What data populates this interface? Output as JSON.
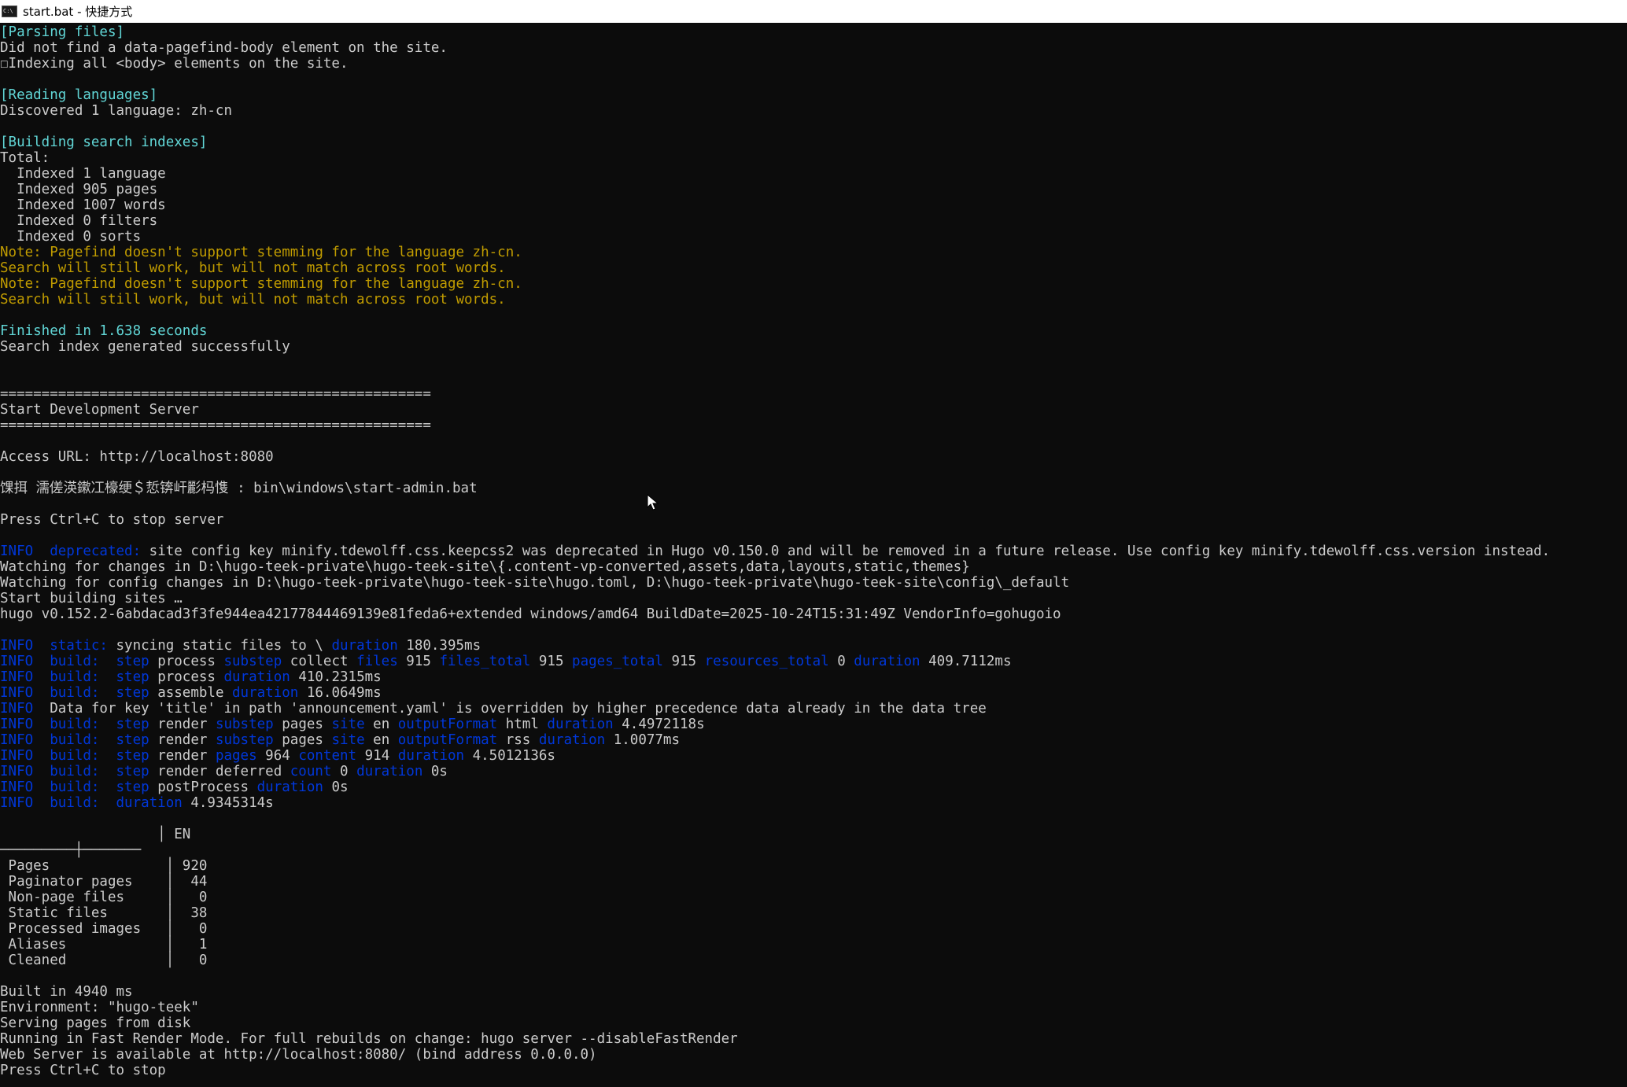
{
  "window": {
    "title": "start.bat - 快捷方式",
    "icon": "cmd-icon",
    "icon_label": "C:\\"
  },
  "colors": {
    "background": "#0c0c0c",
    "default_text": "#cccccc",
    "section_header": "#3a96dd",
    "note": "#c19c00",
    "info_keyword": "#0037da"
  },
  "lines": [
    [
      {
        "t": "[Parsing files]",
        "c": "teal"
      }
    ],
    [
      {
        "t": "Did not find a data-pagefind-body element on the site.",
        "c": "gray"
      }
    ],
    [
      {
        "t": "☐Indexing all <body> elements on the site.",
        "c": "gray"
      }
    ],
    [],
    [
      {
        "t": "[Reading languages]",
        "c": "teal"
      }
    ],
    [
      {
        "t": "Discovered 1 language: zh-cn",
        "c": "gray"
      }
    ],
    [],
    [
      {
        "t": "[Building search indexes]",
        "c": "teal"
      }
    ],
    [
      {
        "t": "Total:",
        "c": "gray"
      }
    ],
    [
      {
        "t": "  Indexed 1 language",
        "c": "gray"
      }
    ],
    [
      {
        "t": "  Indexed 905 pages",
        "c": "gray"
      }
    ],
    [
      {
        "t": "  Indexed 1007 words",
        "c": "gray"
      }
    ],
    [
      {
        "t": "  Indexed 0 filters",
        "c": "gray"
      }
    ],
    [
      {
        "t": "  Indexed 0 sorts",
        "c": "gray"
      }
    ],
    [
      {
        "t": "Note: Pagefind doesn't support stemming for the language zh-cn.",
        "c": "yellow"
      }
    ],
    [
      {
        "t": "Search will still work, but will not match across root words.",
        "c": "yellow"
      }
    ],
    [
      {
        "t": "Note: Pagefind doesn't support stemming for the language zh-cn.",
        "c": "yellow"
      }
    ],
    [
      {
        "t": "Search will still work, but will not match across root words.",
        "c": "yellow"
      }
    ],
    [],
    [
      {
        "t": "Finished in 1.638 seconds",
        "c": "teal"
      }
    ],
    [
      {
        "t": "Search index generated successfully",
        "c": "gray"
      }
    ],
    [],
    [],
    [
      {
        "t": "====================================================",
        "c": "gray"
      }
    ],
    [
      {
        "t": "Start Development Server",
        "c": "gray"
      }
    ],
    [
      {
        "t": "====================================================",
        "c": "gray"
      }
    ],
    [],
    [
      {
        "t": "Access URL: http://localhost:8080",
        "c": "gray"
      }
    ],
    [],
    [
      {
        "t": "馃挕 濡傞渶鏉冮檺绠＄悊锛屽彲杩愯 : bin\\windows\\start-admin.bat",
        "c": "gray"
      }
    ],
    [],
    [
      {
        "t": "Press Ctrl+C to stop server",
        "c": "gray"
      }
    ],
    [],
    [
      {
        "t": "INFO  ",
        "c": "blue"
      },
      {
        "t": "deprecated: ",
        "c": "blue"
      },
      {
        "t": "site config key minify.tdewolff.css.keepcss2 was deprecated in Hugo v0.150.0 and will be removed in a future release. Use config key minify.tdewolff.css.version instead.",
        "c": "gray"
      }
    ],
    [
      {
        "t": "Watching for changes in D:\\hugo-teek-private\\hugo-teek-site\\{.content-vp-converted,assets,data,layouts,static,themes}",
        "c": "gray"
      }
    ],
    [
      {
        "t": "Watching for config changes in D:\\hugo-teek-private\\hugo-teek-site\\hugo.toml, D:\\hugo-teek-private\\hugo-teek-site\\config\\_default",
        "c": "gray"
      }
    ],
    [
      {
        "t": "Start building sites …",
        "c": "gray"
      }
    ],
    [
      {
        "t": "hugo v0.152.2-6abdacad3f3fe944ea42177844469139e81feda6+extended windows/amd64 BuildDate=2025-10-24T15:31:49Z VendorInfo=gohugoio",
        "c": "gray"
      }
    ],
    [],
    [
      {
        "t": "INFO  ",
        "c": "blue"
      },
      {
        "t": "static: ",
        "c": "blue"
      },
      {
        "t": "syncing static files to \\ ",
        "c": "gray"
      },
      {
        "t": "duration ",
        "c": "blue"
      },
      {
        "t": "180.395ms",
        "c": "gray"
      }
    ],
    [
      {
        "t": "INFO  ",
        "c": "blue"
      },
      {
        "t": "build:  step ",
        "c": "blue"
      },
      {
        "t": "process ",
        "c": "gray"
      },
      {
        "t": "substep ",
        "c": "blue"
      },
      {
        "t": "collect ",
        "c": "gray"
      },
      {
        "t": "files ",
        "c": "blue"
      },
      {
        "t": "915 ",
        "c": "gray"
      },
      {
        "t": "files_total ",
        "c": "blue"
      },
      {
        "t": "915 ",
        "c": "gray"
      },
      {
        "t": "pages_total ",
        "c": "blue"
      },
      {
        "t": "915 ",
        "c": "gray"
      },
      {
        "t": "resources_total ",
        "c": "blue"
      },
      {
        "t": "0 ",
        "c": "gray"
      },
      {
        "t": "duration ",
        "c": "blue"
      },
      {
        "t": "409.7112ms",
        "c": "gray"
      }
    ],
    [
      {
        "t": "INFO  ",
        "c": "blue"
      },
      {
        "t": "build:  step ",
        "c": "blue"
      },
      {
        "t": "process ",
        "c": "gray"
      },
      {
        "t": "duration ",
        "c": "blue"
      },
      {
        "t": "410.2315ms",
        "c": "gray"
      }
    ],
    [
      {
        "t": "INFO  ",
        "c": "blue"
      },
      {
        "t": "build:  step ",
        "c": "blue"
      },
      {
        "t": "assemble ",
        "c": "gray"
      },
      {
        "t": "duration ",
        "c": "blue"
      },
      {
        "t": "16.0649ms",
        "c": "gray"
      }
    ],
    [
      {
        "t": "INFO  ",
        "c": "blue"
      },
      {
        "t": "Data for key 'title' in path 'announcement.yaml' is overridden by higher precedence data already in the data tree",
        "c": "gray"
      }
    ],
    [
      {
        "t": "INFO  ",
        "c": "blue"
      },
      {
        "t": "build:  step ",
        "c": "blue"
      },
      {
        "t": "render ",
        "c": "gray"
      },
      {
        "t": "substep ",
        "c": "blue"
      },
      {
        "t": "pages ",
        "c": "gray"
      },
      {
        "t": "site ",
        "c": "blue"
      },
      {
        "t": "en ",
        "c": "gray"
      },
      {
        "t": "outputFormat ",
        "c": "blue"
      },
      {
        "t": "html ",
        "c": "gray"
      },
      {
        "t": "duration ",
        "c": "blue"
      },
      {
        "t": "4.4972118s",
        "c": "gray"
      }
    ],
    [
      {
        "t": "INFO  ",
        "c": "blue"
      },
      {
        "t": "build:  step ",
        "c": "blue"
      },
      {
        "t": "render ",
        "c": "gray"
      },
      {
        "t": "substep ",
        "c": "blue"
      },
      {
        "t": "pages ",
        "c": "gray"
      },
      {
        "t": "site ",
        "c": "blue"
      },
      {
        "t": "en ",
        "c": "gray"
      },
      {
        "t": "outputFormat ",
        "c": "blue"
      },
      {
        "t": "rss ",
        "c": "gray"
      },
      {
        "t": "duration ",
        "c": "blue"
      },
      {
        "t": "1.0077ms",
        "c": "gray"
      }
    ],
    [
      {
        "t": "INFO  ",
        "c": "blue"
      },
      {
        "t": "build:  step ",
        "c": "blue"
      },
      {
        "t": "render ",
        "c": "gray"
      },
      {
        "t": "pages ",
        "c": "blue"
      },
      {
        "t": "964 ",
        "c": "gray"
      },
      {
        "t": "content ",
        "c": "blue"
      },
      {
        "t": "914 ",
        "c": "gray"
      },
      {
        "t": "duration ",
        "c": "blue"
      },
      {
        "t": "4.5012136s",
        "c": "gray"
      }
    ],
    [
      {
        "t": "INFO  ",
        "c": "blue"
      },
      {
        "t": "build:  step ",
        "c": "blue"
      },
      {
        "t": "render deferred ",
        "c": "gray"
      },
      {
        "t": "count ",
        "c": "blue"
      },
      {
        "t": "0 ",
        "c": "gray"
      },
      {
        "t": "duration ",
        "c": "blue"
      },
      {
        "t": "0s",
        "c": "gray"
      }
    ],
    [
      {
        "t": "INFO  ",
        "c": "blue"
      },
      {
        "t": "build:  step ",
        "c": "blue"
      },
      {
        "t": "postProcess ",
        "c": "gray"
      },
      {
        "t": "duration ",
        "c": "blue"
      },
      {
        "t": "0s",
        "c": "gray"
      }
    ],
    [
      {
        "t": "INFO  ",
        "c": "blue"
      },
      {
        "t": "build:  duration ",
        "c": "blue"
      },
      {
        "t": "4.9345314s",
        "c": "gray"
      }
    ],
    [],
    [
      {
        "t": "                   │ EN",
        "c": "gray"
      }
    ],
    [
      {
        "t": "─────────┼───────",
        "c": "gray"
      }
    ],
    [
      {
        "t": " Pages              │ 920",
        "c": "gray"
      }
    ],
    [
      {
        "t": " Paginator pages    │  44",
        "c": "gray"
      }
    ],
    [
      {
        "t": " Non-page files     │   0",
        "c": "gray"
      }
    ],
    [
      {
        "t": " Static files       │  38",
        "c": "gray"
      }
    ],
    [
      {
        "t": " Processed images   │   0",
        "c": "gray"
      }
    ],
    [
      {
        "t": " Aliases            │   1",
        "c": "gray"
      }
    ],
    [
      {
        "t": " Cleaned            │   0",
        "c": "gray"
      }
    ],
    [],
    [
      {
        "t": "Built in 4940 ms",
        "c": "gray"
      }
    ],
    [
      {
        "t": "Environment: \"hugo-teek\"",
        "c": "gray"
      }
    ],
    [
      {
        "t": "Serving pages from disk",
        "c": "gray"
      }
    ],
    [
      {
        "t": "Running in Fast Render Mode. For full rebuilds on change: hugo server --disableFastRender",
        "c": "gray"
      }
    ],
    [
      {
        "t": "Web Server is available at http://localhost:8080/ (bind address 0.0.0.0)",
        "c": "gray"
      }
    ],
    [
      {
        "t": "Press Ctrl+C to stop",
        "c": "gray"
      }
    ]
  ]
}
